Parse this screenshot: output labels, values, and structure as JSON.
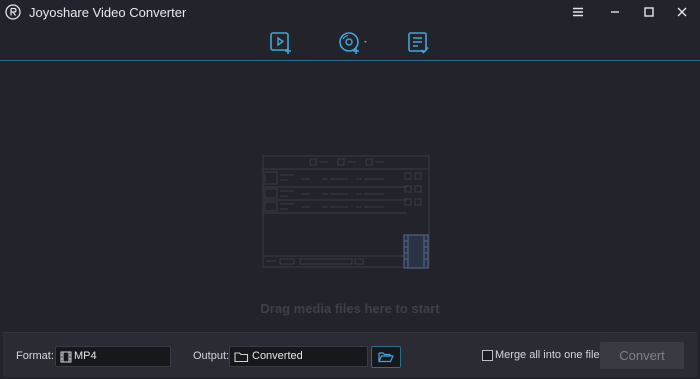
{
  "app": {
    "title": "Joyoshare Video Converter",
    "accent_color": "#3fa6d8"
  },
  "window_controls": [
    "menu-icon",
    "minimize-icon",
    "maximize-icon",
    "close-icon"
  ],
  "toolbar": {
    "buttons": [
      {
        "name": "add-video",
        "icon": "video-plus-icon"
      },
      {
        "name": "add-dvd",
        "icon": "disc-plus-icon",
        "has_dropdown": true
      },
      {
        "name": "task-list",
        "icon": "list-check-icon"
      }
    ]
  },
  "drop_area": {
    "hint": "Drag media files here to start"
  },
  "bottom": {
    "format_label": "Format:",
    "format_value": "MP4",
    "output_label": "Output:",
    "output_value": "Converted",
    "merge_label": "Merge all into one file",
    "merge_checked": false,
    "convert_label": "Convert"
  }
}
